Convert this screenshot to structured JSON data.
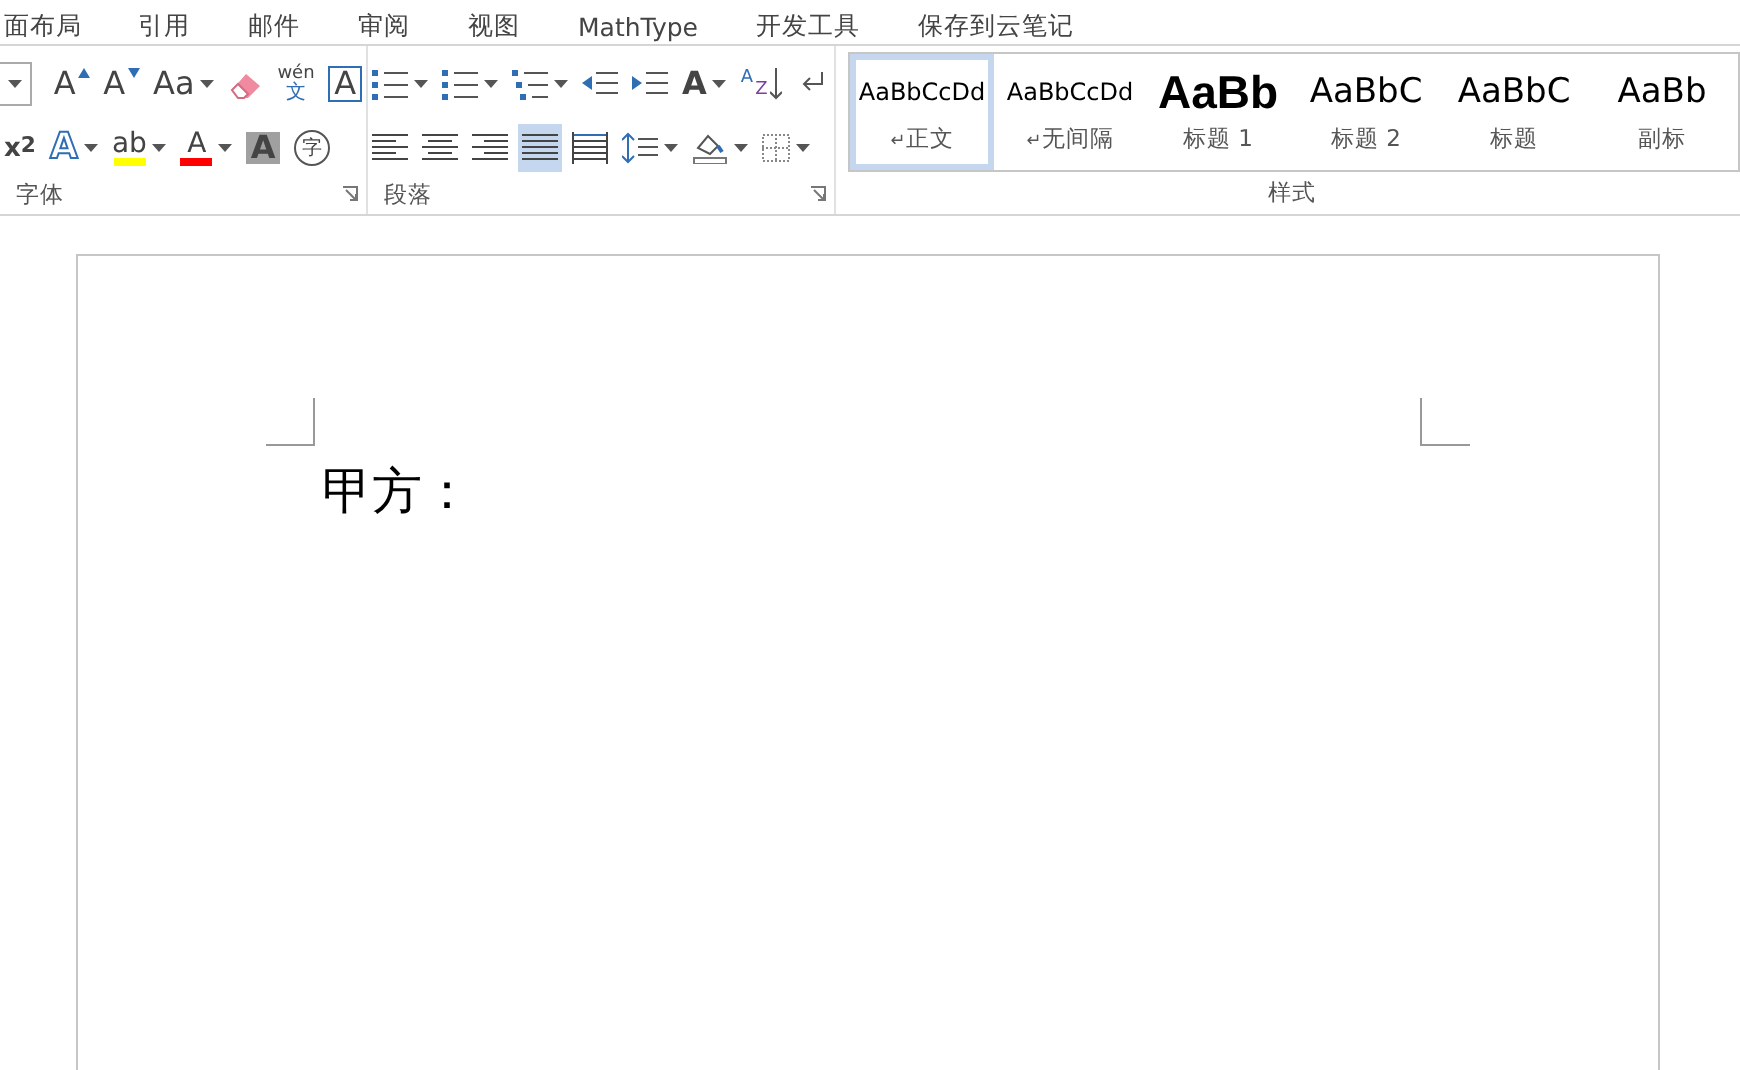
{
  "menu_tabs": [
    {
      "label": "面布局"
    },
    {
      "label": "引用"
    },
    {
      "label": "邮件"
    },
    {
      "label": "审阅"
    },
    {
      "label": "视图"
    },
    {
      "label": "MathType"
    },
    {
      "label": "开发工具"
    },
    {
      "label": "保存到云笔记"
    }
  ],
  "font_group": {
    "label": "字体",
    "row1": [
      {
        "kind": "sizebox",
        "dropdown": true
      },
      {
        "kind": "grow",
        "text": "A"
      },
      {
        "kind": "shrink",
        "text": "A"
      },
      {
        "kind": "case",
        "text": "Aa",
        "dropdown": true
      },
      {
        "kind": "eraser"
      },
      {
        "kind": "phonetic",
        "text": "wén",
        "sub": "文"
      },
      {
        "kind": "border",
        "text": "A"
      }
    ],
    "row2": [
      {
        "kind": "superscript",
        "text": "x$^{2}$"
      },
      {
        "kind": "effects",
        "text": "A",
        "dropdown": true
      },
      {
        "kind": "highlight",
        "text": "ab",
        "color": "#ffff00",
        "dropdown": true
      },
      {
        "kind": "fontcolor",
        "text": "A",
        "color": "#ff0000",
        "dropdown": true
      },
      {
        "kind": "shading",
        "text": "A"
      },
      {
        "kind": "enclose",
        "text": "字"
      }
    ]
  },
  "paragraph_group": {
    "label": "段落",
    "row1": [
      {
        "kind": "bullets",
        "dropdown": true
      },
      {
        "kind": "numbering",
        "dropdown": true
      },
      {
        "kind": "multilevel",
        "dropdown": true
      },
      {
        "kind": "outdent"
      },
      {
        "kind": "indent"
      },
      {
        "kind": "asian",
        "text": "A",
        "dropdown": true
      },
      {
        "kind": "sort",
        "text": "A",
        "sub": "Z"
      },
      {
        "kind": "marks"
      }
    ],
    "row2": [
      {
        "kind": "left",
        "selected": false
      },
      {
        "kind": "center",
        "selected": false
      },
      {
        "kind": "right",
        "selected": false
      },
      {
        "kind": "justify",
        "selected": true
      },
      {
        "kind": "distributed",
        "selected": false
      },
      {
        "kind": "spacing",
        "dropdown": true
      },
      {
        "kind": "fill",
        "dropdown": true
      },
      {
        "kind": "borders",
        "dropdown": true
      }
    ]
  },
  "styles_group": {
    "label": "样式",
    "items": [
      {
        "preview": "AaBbCcDd",
        "name": "正文",
        "kind": "body",
        "mark": "↵",
        "selected": true
      },
      {
        "preview": "AaBbCcDd",
        "name": "无间隔",
        "kind": "body",
        "mark": "↵",
        "selected": false
      },
      {
        "preview": "AaBb",
        "name": "标题 1",
        "kind": "h1",
        "selected": false
      },
      {
        "preview": "AaBbC",
        "name": "标题 2",
        "kind": "h2",
        "selected": false
      },
      {
        "preview": "AaBbC",
        "name": "标题",
        "kind": "title",
        "selected": false
      },
      {
        "preview": "AaBb",
        "name": "副标",
        "kind": "subtitle",
        "selected": false
      }
    ]
  },
  "document": {
    "text": "甲方："
  }
}
